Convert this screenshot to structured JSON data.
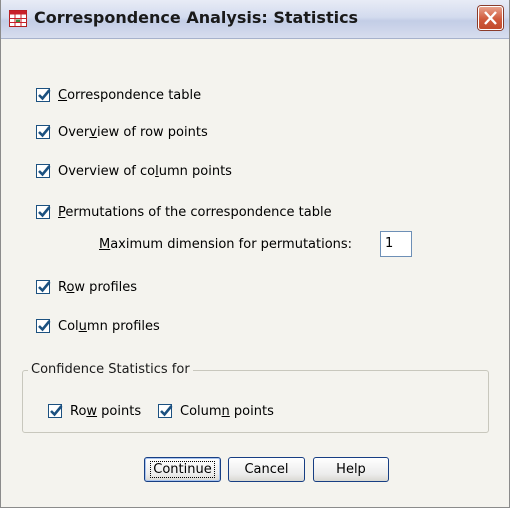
{
  "window": {
    "title": "Correspondence Analysis: Statistics",
    "close_label": "X"
  },
  "options": {
    "correspondence_table": {
      "pre": "",
      "u": "C",
      "post": "orrespondence table",
      "checked": true
    },
    "row_points": {
      "pre": "Over",
      "u": "v",
      "post": "iew of row points",
      "checked": true
    },
    "column_points": {
      "pre": "Overview of co",
      "u": "l",
      "post": "umn points",
      "checked": true
    },
    "permutations": {
      "pre": "",
      "u": "P",
      "post": "ermutations of the correspondence table",
      "checked": true
    },
    "row_profiles": {
      "pre": "R",
      "u": "o",
      "post": "w profiles",
      "checked": true
    },
    "column_profiles": {
      "pre": "Col",
      "u": "u",
      "post": "mn profiles",
      "checked": true
    }
  },
  "max_dimension": {
    "label_u": "M",
    "label_rest": "aximum dimension for permutations:",
    "value": "1"
  },
  "confidence": {
    "legend": "Confidence Statistics for",
    "row_points": {
      "pre": "Ro",
      "u": "w",
      "post": " points",
      "checked": true
    },
    "column_points": {
      "pre": "Colum",
      "u": "n",
      "post": " points",
      "checked": true
    }
  },
  "buttons": {
    "continue": "Continue",
    "cancel": "Cancel",
    "help": "Help"
  },
  "colors": {
    "check": "#1c5180",
    "close": "#d05a3c"
  }
}
